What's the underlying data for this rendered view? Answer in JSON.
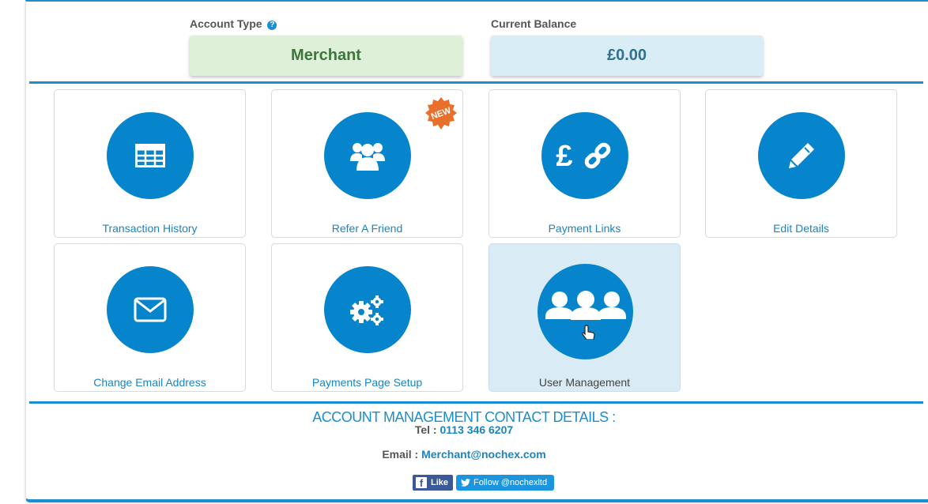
{
  "account": {
    "type_label": "Account Type",
    "type_value": "Merchant",
    "balance_label": "Current Balance",
    "balance_value": "£0.00",
    "help_glyph": "?"
  },
  "tiles": [
    {
      "label": "Transaction History",
      "icon": "table-icon"
    },
    {
      "label": "Refer A Friend",
      "icon": "group-icon",
      "badge": "NEW"
    },
    {
      "label": "Payment Links",
      "icon": "pound-link-icon"
    },
    {
      "label": "Edit Details",
      "icon": "pencil-icon"
    },
    {
      "label": "Change Email Address",
      "icon": "envelope-icon"
    },
    {
      "label": "Payments Page Setup",
      "icon": "gears-icon"
    },
    {
      "label": "User Management",
      "icon": "users-icon",
      "active": true
    }
  ],
  "contact": {
    "title": "ACCOUNT MANAGEMENT CONTACT DETAILS :",
    "tel_label": "Tel :",
    "tel_value": "0113 346 6207",
    "email_label": "Email :",
    "email_value": "Merchant@nochex.com"
  },
  "social": {
    "fb_label": "Like",
    "tw_label": "Follow @nochexltd"
  },
  "colors": {
    "accent": "#1a8ed0",
    "circle": "#0685cc",
    "merchant_bg": "#dff0d8",
    "merchant_text": "#3c763d",
    "balance_bg": "#d9edf7",
    "balance_text": "#31708f",
    "badge": "#e8702a"
  }
}
